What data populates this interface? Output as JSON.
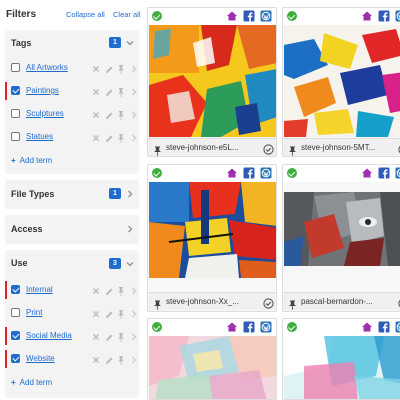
{
  "filters": {
    "title": "Filters",
    "collapse_all": "Collapse all",
    "clear_all": "Clear all"
  },
  "tags": {
    "title": "Tags",
    "count": "1",
    "items": [
      {
        "label": "All Artworks",
        "checked": false
      },
      {
        "label": "Paintings",
        "checked": true
      },
      {
        "label": "Sculptures",
        "checked": false
      },
      {
        "label": "Statues",
        "checked": false
      }
    ],
    "add_term": "Add term"
  },
  "file_types": {
    "title": "File Types",
    "count": "1"
  },
  "access": {
    "title": "Access"
  },
  "use": {
    "title": "Use",
    "count": "3",
    "items": [
      {
        "label": "Internal",
        "checked": true
      },
      {
        "label": "Print",
        "checked": false
      },
      {
        "label": "Social Media",
        "checked": true
      },
      {
        "label": "Website",
        "checked": true
      }
    ],
    "add_term": "Add term"
  },
  "media": [
    {
      "filename": "steve-johnson-e5L...",
      "approved": true
    },
    {
      "filename": "steve-johnson-5MT...",
      "approved": true
    },
    {
      "filename": "steve-johnson-Xx_...",
      "approved": true
    },
    {
      "filename": "pascal-bernardon-...",
      "approved": true
    },
    {
      "filename": "",
      "approved": true
    },
    {
      "filename": "",
      "approved": true
    }
  ],
  "colors": {
    "accent": "#1e6ccf",
    "active_marker": "#d9242a",
    "approved_green": "#3fae3f",
    "tags_icon_purple": "#a02fb0",
    "facebook_blue": "#2f5bb5",
    "wordpress_blue": "#2e74b8"
  },
  "icons": [
    "check-circle-icon",
    "tag-icon",
    "facebook-icon",
    "wordpress-icon",
    "pin-icon",
    "close-icon",
    "edit-icon",
    "chevron-right-icon",
    "chevron-down-icon",
    "plus-icon"
  ]
}
